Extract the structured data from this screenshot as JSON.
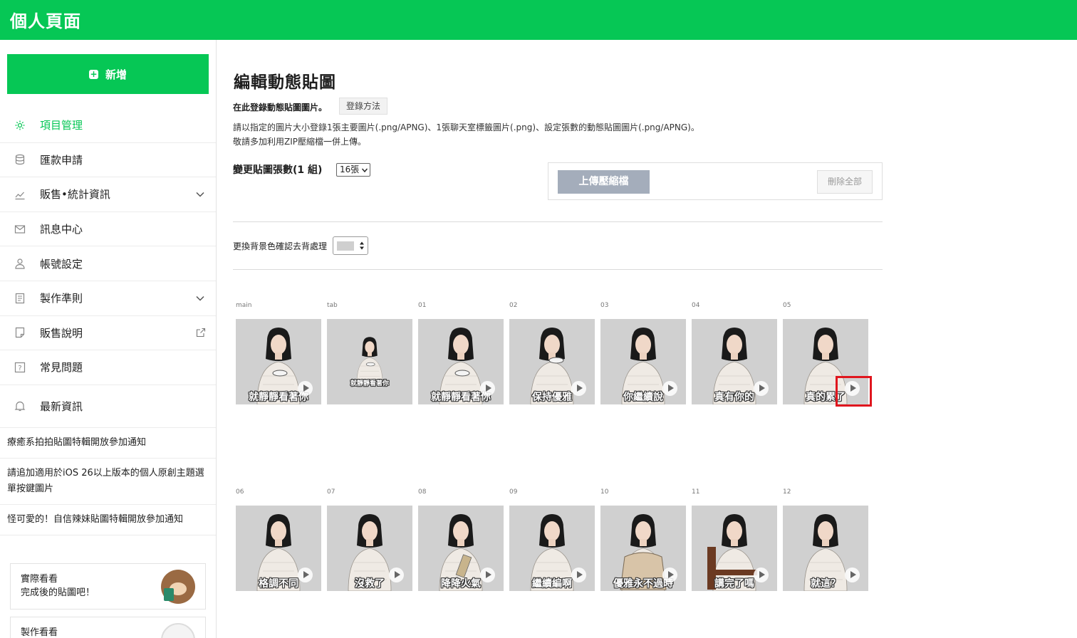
{
  "header": {
    "title": "個人頁面"
  },
  "sidebar": {
    "new_button": "新增",
    "items": [
      {
        "label": "項目管理",
        "icon": "gear-icon",
        "active": true
      },
      {
        "label": "匯款申請",
        "icon": "database-icon"
      },
      {
        "label": "販售•統計資訊",
        "icon": "chart-icon",
        "expandable": true
      },
      {
        "label": "訊息中心",
        "icon": "mail-icon"
      },
      {
        "label": "帳號設定",
        "icon": "user-icon"
      },
      {
        "label": "製作準則",
        "icon": "document-icon",
        "expandable": true
      },
      {
        "label": "販售說明",
        "icon": "note-icon",
        "external": true
      },
      {
        "label": "常見問題",
        "icon": "question-icon"
      }
    ],
    "news_title": "最新資訊",
    "news": [
      "療癒系拍拍貼圖特輯開放參加通知",
      "請追加適用於iOS 26以上版本的個人原創主題選單按鍵圖片",
      "怪可愛的！自信辣妹貼圖特輯開放參加通知"
    ],
    "promos": [
      {
        "line1": "實際看看",
        "line2": "完成後的貼圖吧！"
      },
      {
        "line1": "製作看看",
        "line2": ""
      }
    ]
  },
  "main": {
    "title": "編輯動態貼圖",
    "subtitle": "在此登錄動態貼圖圖片。",
    "howto_button": "登錄方法",
    "desc_line1": "請以指定的圖片大小登錄1張主要圖片(.png/APNG)、1張聊天室標籤圖片(.png)、設定張數的動態貼圖圖片(.png/APNG)。",
    "desc_line2": "敬請多加利用ZIP壓縮檔一併上傳。",
    "count_label": "變更貼圖張數(1 組)",
    "count_value": "16張",
    "upload_button": "上傳壓縮檔",
    "delete_all_button": "刪除全部",
    "bg_label": "更換背景色確認去背處理",
    "bg_color": "#cfcfcf"
  },
  "stickers": [
    {
      "num": "main",
      "caption": "就靜靜看著你",
      "pose": "cup"
    },
    {
      "num": "tab",
      "caption": "就靜靜看著你",
      "pose": "cup",
      "small": true
    },
    {
      "num": "01",
      "caption": "就靜靜看著你",
      "pose": "cup"
    },
    {
      "num": "02",
      "caption": "保持優雅",
      "pose": "sip"
    },
    {
      "num": "03",
      "caption": "你繼續說",
      "pose": "nail"
    },
    {
      "num": "04",
      "caption": "真有你的",
      "pose": "laugh"
    },
    {
      "num": "05",
      "caption": "真的累了",
      "pose": "plain"
    },
    {
      "num": "06",
      "caption": "格調不同",
      "pose": "chin"
    },
    {
      "num": "07",
      "caption": "沒救了",
      "pose": "plain"
    },
    {
      "num": "08",
      "caption": "降降火氣",
      "pose": "fan"
    },
    {
      "num": "09",
      "caption": "繼續編啊",
      "pose": "chin"
    },
    {
      "num": "10",
      "caption": "優雅永不過時",
      "pose": "fur"
    },
    {
      "num": "11",
      "caption": "講完了嗎",
      "pose": "chair"
    },
    {
      "num": "12",
      "caption": "就這？",
      "pose": "chin"
    }
  ],
  "highlighted_sticker": "05",
  "colors": {
    "brand": "#06c755",
    "highlight": "#e0161e",
    "upload_disabled": "#a4adbb"
  }
}
